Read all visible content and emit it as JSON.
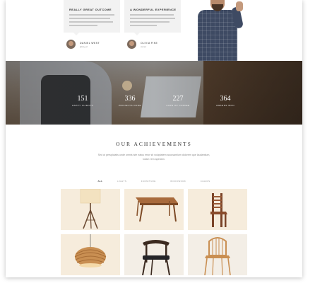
{
  "testimonials": [
    {
      "title": "REALLY GREAT OUTCOME",
      "name": "DANIEL WEST",
      "role": "@dq_wt"
    },
    {
      "title": "A WONDERFUL EXPERIENCE",
      "name": "OLIVIA FIKE",
      "role": "owner"
    }
  ],
  "stats": [
    {
      "number": "151",
      "label": "HAPPY CLIENTS"
    },
    {
      "number": "336",
      "label": "PROJECTS DONE"
    },
    {
      "number": "227",
      "label": "CUPS OF COFFEE"
    },
    {
      "number": "364",
      "label": "AWARDS WON"
    }
  ],
  "achievements": {
    "title": "OUR ACHIEVEMENTS",
    "description": "Sed ut perspiciatis unde omnis iste natus error sit voluptatem accusantium dolorem que laudantium, totam rem aperiam.",
    "filters": [
      "ALL",
      "LIGHTS",
      "FURNITURE",
      "WOODWORK",
      "CHAIRS"
    ],
    "active_filter": "ALL",
    "items": [
      "lamp-tripod",
      "table",
      "chair-slatted",
      "lamp-pendant",
      "chair-armchair",
      "chair-spindle"
    ]
  }
}
